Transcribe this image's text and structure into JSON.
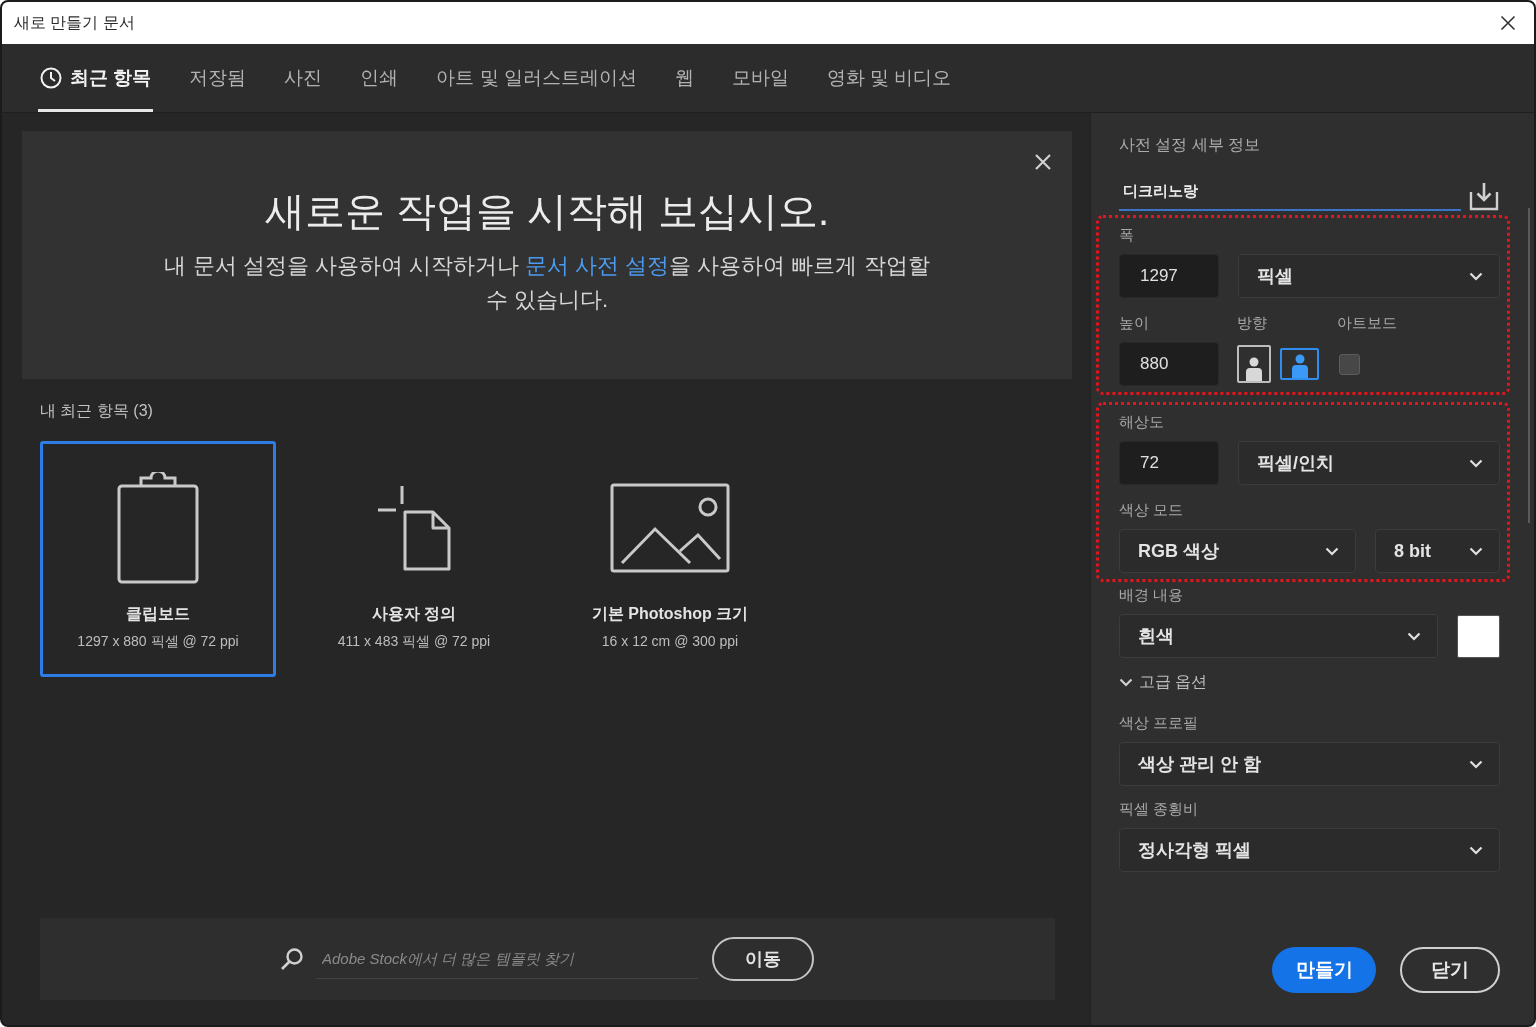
{
  "window": {
    "title": "새로 만들기 문서"
  },
  "tabs": [
    {
      "label": "최근 항목",
      "kind": "recent",
      "selected": true
    },
    {
      "label": "저장됨",
      "kind": "preset",
      "selected": false
    },
    {
      "label": "사진",
      "kind": "preset",
      "selected": false
    },
    {
      "label": "인쇄",
      "kind": "preset",
      "selected": false
    },
    {
      "label": "아트 및 일러스트레이션",
      "kind": "preset",
      "selected": false
    },
    {
      "label": "웹",
      "kind": "preset",
      "selected": false
    },
    {
      "label": "모바일",
      "kind": "preset",
      "selected": false
    },
    {
      "label": "영화 및 비디오",
      "kind": "preset",
      "selected": false
    }
  ],
  "welcome": {
    "title": "새로운 작업을 시작해 보십시오.",
    "text_before": "내 문서 설정을 사용하여 시작하거나 ",
    "link": "문서 사전 설정",
    "text_after": "을 사용하여 빠르게 작업할 수 있습니다."
  },
  "recent": {
    "heading": "내 최근 항목 (3)",
    "items": [
      {
        "name": "클립보드",
        "detail": "1297 x 880 픽셀 @ 72 ppi",
        "kind": "clipboard",
        "selected": true
      },
      {
        "name": "사용자 정의",
        "detail": "411 x 483 픽셀 @ 72 ppi",
        "kind": "custom",
        "selected": false
      },
      {
        "name": "기본 Photoshop 크기",
        "detail": "16 x 12 cm @ 300 ppi",
        "kind": "default",
        "selected": false
      }
    ]
  },
  "search": {
    "placeholder": "Adobe Stock에서 더 많은 템플릿 찾기",
    "button": "이동"
  },
  "details": {
    "title": "사전 설정 세부 정보",
    "preset_name": "디크리노랑",
    "size_group": {
      "highlighted": true,
      "width": {
        "label": "폭",
        "value": "1297",
        "unit": "픽셀"
      },
      "height": {
        "label": "높이",
        "value": "880"
      },
      "orientation": {
        "label": "방향",
        "options": [
          {
            "kind": "portrait",
            "selected": false
          },
          {
            "kind": "landscape",
            "selected": true
          }
        ]
      },
      "artboard": {
        "label": "아트보드",
        "checked": false
      }
    },
    "format_group": {
      "highlighted": true,
      "resolution": {
        "label": "해상도",
        "value": "72",
        "unit": "픽셀/인치"
      },
      "color_mode": {
        "label": "색상 모드",
        "mode": "RGB 색상",
        "depth": "8 bit"
      }
    },
    "background": {
      "label": "배경 내용",
      "value": "흰색",
      "color": "#ffffff"
    },
    "advanced": {
      "label": "고급 옵션",
      "expanded": true
    },
    "color_profile": {
      "label": "색상 프로필",
      "value": "색상 관리 안 함"
    },
    "pixel_aspect": {
      "label": "픽셀 종횡비",
      "value": "정사각형 픽셀"
    }
  },
  "actions": [
    {
      "label": "만들기",
      "kind": "primary"
    },
    {
      "label": "닫기",
      "kind": "secondary"
    }
  ]
}
